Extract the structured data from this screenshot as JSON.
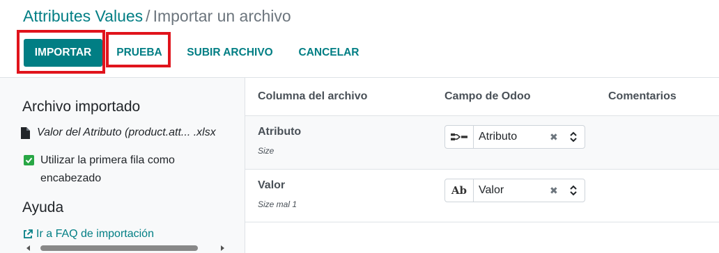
{
  "breadcrumb": {
    "parent": "Attributes Values",
    "separator": "/",
    "current": "Importar un archivo"
  },
  "toolbar": {
    "import_label": "IMPORTAR",
    "test_label": "PRUEBA",
    "upload_label": "SUBIR ARCHIVO",
    "cancel_label": "CANCELAR"
  },
  "sidebar": {
    "imported_title": "Archivo importado",
    "file_name": "Valor del Atributo (product.att... .xlsx",
    "first_row_header_label": "Utilizar la primera fila como encabezado",
    "first_row_header_checked": true,
    "help_title": "Ayuda",
    "faq_link": "Ir a FAQ de importación"
  },
  "table": {
    "columns": [
      "Columna del archivo",
      "Campo de Odoo",
      "Comentarios"
    ],
    "rows": [
      {
        "column": "Atributo",
        "sample": "Size",
        "field_icon": "many2one-relation-icon",
        "field_value": "Atributo"
      },
      {
        "column": "Valor",
        "sample": "Size mal 1",
        "field_icon": "text-ab-icon",
        "field_value": "Valor"
      }
    ]
  },
  "colors": {
    "accent": "#017e84",
    "highlight": "#e0141c",
    "checkbox": "#28a745"
  }
}
